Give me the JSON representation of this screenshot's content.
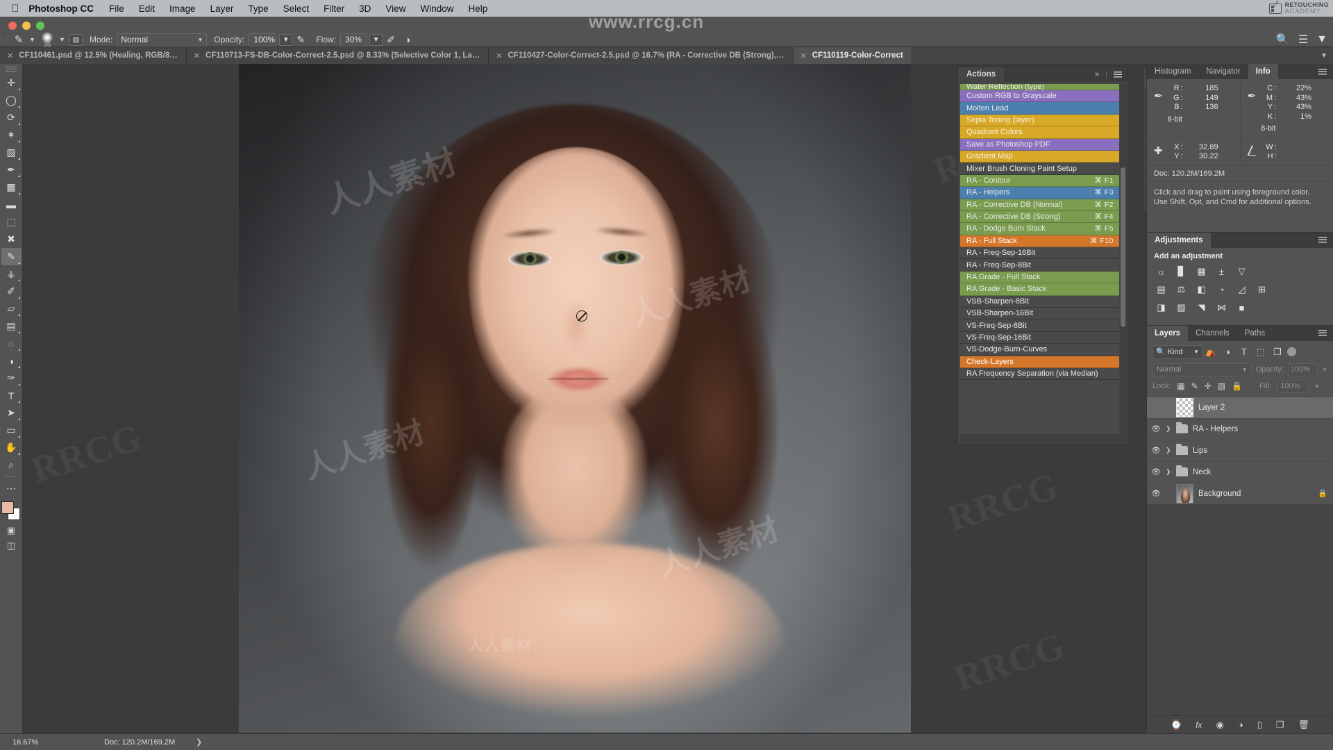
{
  "os_menu": {
    "apple_icon": "apple-icon",
    "app_name": "Photoshop CC",
    "items": [
      "File",
      "Edit",
      "Image",
      "Layer",
      "Type",
      "Select",
      "Filter",
      "3D",
      "View",
      "Window",
      "Help"
    ],
    "brand": {
      "line1": "RETOUCHING",
      "line2": "ACADEMY"
    }
  },
  "options_bar": {
    "tool_icon": "brush-tool-icon",
    "brush_size": "35",
    "brush_panel_icon": "brush-panel-icon",
    "mode_label": "Mode:",
    "mode_value": "Normal",
    "opacity_label": "Opacity:",
    "opacity_value": "100%",
    "opacity_pressure_icon": "pressure-opacity-icon",
    "flow_label": "Flow:",
    "flow_value": "30%",
    "airbrush_icon": "airbrush-icon",
    "smoothing_icon": "smoothing-icon",
    "search_icon": "search-icon",
    "workspace_icon": "workspace-icon"
  },
  "tabs": [
    {
      "close": "×",
      "title": "CF110461.psd @ 12.5% (Healing, RGB/8…",
      "active": false
    },
    {
      "close": "×",
      "title": "CF110713-FS-DB-Color-Correct-2.5.psd @ 8.33% (Selective Color 1, La…",
      "active": false
    },
    {
      "close": "×",
      "title": "CF110427-Color-Correct-2.5.psd @ 16.7% (RA - Corrective DB (Strong),…",
      "active": false
    },
    {
      "close": "×",
      "title": "CF110119-Color-Correct",
      "active": true
    }
  ],
  "toolbar": {
    "tools": [
      {
        "name": "move-tool",
        "glyph": "✛",
        "has_submenu": true,
        "selected": false
      },
      {
        "name": "marquee-tool",
        "glyph": "◯",
        "has_submenu": true,
        "selected": false
      },
      {
        "name": "lasso-tool",
        "glyph": "⤵",
        "has_submenu": true,
        "selected": false
      },
      {
        "name": "quick-selection-tool",
        "glyph": "✦",
        "has_submenu": true,
        "selected": false
      },
      {
        "name": "crop-tool",
        "glyph": "⌧",
        "has_submenu": true,
        "selected": false
      },
      {
        "name": "eyedropper-tool",
        "glyph": "✒",
        "has_submenu": true,
        "selected": false
      },
      {
        "name": "spot-healing-brush-tool",
        "glyph": "◩",
        "has_submenu": true,
        "selected": false
      },
      {
        "name": "healing-brush-tool",
        "glyph": "✐",
        "has_submenu": false,
        "selected": false
      },
      {
        "name": "patch-tool",
        "glyph": "⬚",
        "has_submenu": false,
        "selected": false
      },
      {
        "name": "content-aware-move-tool",
        "glyph": "✖",
        "has_submenu": false,
        "selected": false
      },
      {
        "name": "brush-tool",
        "glyph": "✐",
        "has_submenu": true,
        "selected": true
      },
      {
        "name": "clone-stamp-tool",
        "glyph": "⚑",
        "has_submenu": true,
        "selected": false
      },
      {
        "name": "history-brush-tool",
        "glyph": "✒",
        "has_submenu": true,
        "selected": false
      },
      {
        "name": "eraser-tool",
        "glyph": "▱",
        "has_submenu": true,
        "selected": false
      },
      {
        "name": "gradient-tool",
        "glyph": "▤",
        "has_submenu": true,
        "selected": false
      },
      {
        "name": "blur-tool",
        "glyph": "◌",
        "has_submenu": true,
        "selected": false
      },
      {
        "name": "dodge-tool",
        "glyph": "◑",
        "has_submenu": true,
        "selected": false
      },
      {
        "name": "pen-tool",
        "glyph": "✑",
        "has_submenu": true,
        "selected": false
      },
      {
        "name": "type-tool",
        "glyph": "T",
        "has_submenu": true,
        "selected": false
      },
      {
        "name": "path-selection-tool",
        "glyph": "➤",
        "has_submenu": true,
        "selected": false
      },
      {
        "name": "rectangle-tool",
        "glyph": "▭",
        "has_submenu": true,
        "selected": false
      },
      {
        "name": "hand-tool",
        "glyph": "✋",
        "has_submenu": true,
        "selected": false
      },
      {
        "name": "zoom-tool",
        "glyph": "⌕",
        "has_submenu": false,
        "selected": false
      },
      {
        "name": "more-tools",
        "glyph": "⋯",
        "has_submenu": false,
        "selected": false
      }
    ],
    "foreground_color": "#e8b9a4",
    "background_color": "#ffffff",
    "quick-mask-icon": "quick-mask-icon",
    "screen-mode-icon": "screen-mode-icon"
  },
  "actions_panel": {
    "tab_label": "Actions",
    "collapse_icon": "chevron-double-right-icon",
    "menu_icon": "panel-menu-icon",
    "items": [
      {
        "label": "Water Reflection (type)",
        "key": "",
        "color": "green",
        "clipped": true
      },
      {
        "label": "Custom RGB to Grayscale",
        "key": "",
        "color": "purple"
      },
      {
        "label": "Molten Lead",
        "key": "",
        "color": "blue"
      },
      {
        "label": "Sepia Toning (layer)",
        "key": "",
        "color": "gold"
      },
      {
        "label": "Quadrant Colors",
        "key": "",
        "color": "gold"
      },
      {
        "label": "Save as Photoshop PDF",
        "key": "",
        "color": "purple"
      },
      {
        "label": "Gradient Map",
        "key": "",
        "color": "gold"
      },
      {
        "label": "Mixer Brush Cloning Paint Setup",
        "key": "",
        "color": "plain"
      },
      {
        "label": "RA - Contour",
        "key": "⌘ F1",
        "color": "green"
      },
      {
        "label": "RA - Helpers",
        "key": "⌘ F3",
        "color": "bluesel"
      },
      {
        "label": "RA - Corrective DB (Normal)",
        "key": "⌘ F2",
        "color": "green"
      },
      {
        "label": "RA - Corrective DB (Strong)",
        "key": "⌘ F4",
        "color": "green"
      },
      {
        "label": "RA - Dodge Burn Stack",
        "key": "⌘ F5",
        "color": "green"
      },
      {
        "label": "RA - Full Stack",
        "key": "⌘ F10",
        "color": "orange"
      },
      {
        "label": "RA - Freq-Sep-16Bit",
        "key": "",
        "color": "plain"
      },
      {
        "label": "RA - Freq-Sep-8Bit",
        "key": "",
        "color": "plain"
      },
      {
        "label": "RA Grade - Full Stack",
        "key": "",
        "color": "green"
      },
      {
        "label": "RA Grade - Basic Stack",
        "key": "",
        "color": "green"
      },
      {
        "label": "VSB-Sharpen-8Bit",
        "key": "",
        "color": "plain"
      },
      {
        "label": "VSB-Sharpen-16Bit",
        "key": "",
        "color": "plain"
      },
      {
        "label": "VS-Freq-Sep-8Bit",
        "key": "",
        "color": "plain"
      },
      {
        "label": "VS-Freq-Sep-16Bit",
        "key": "",
        "color": "plain"
      },
      {
        "label": "VS-Dodge-Burn-Curves",
        "key": "",
        "color": "plain"
      },
      {
        "label": "Check-Layers",
        "key": "",
        "color": "orange"
      },
      {
        "label": "RA Frequency Separation (via Median)",
        "key": "",
        "color": "plain"
      }
    ]
  },
  "icon_dock": {
    "groups": [
      [
        {
          "name": "play-action-icon",
          "glyph": "▶",
          "active": true
        }
      ],
      [
        {
          "name": "libraries-icon",
          "glyph": "⎇",
          "active": false
        },
        {
          "name": "3d-icon",
          "glyph": "⬛",
          "active": false
        }
      ],
      [
        {
          "name": "brush-presets-icon",
          "glyph": "❁",
          "active": false
        },
        {
          "name": "brush-settings-icon",
          "glyph": "⚒",
          "active": false
        }
      ],
      [
        {
          "name": "tool-presets-icon",
          "glyph": "☰",
          "active": false
        }
      ]
    ]
  },
  "info_panel": {
    "tabs": [
      "Histogram",
      "Navigator",
      "Info"
    ],
    "active_tab": "Info",
    "menu_icon": "panel-menu-icon",
    "rgb": {
      "icon": "eyedropper-icon",
      "R": "185",
      "G": "149",
      "B": "136",
      "bit": "8-bit"
    },
    "cmyk": {
      "icon": "eyedropper-icon",
      "C": "22%",
      "M": "43%",
      "Y": "43%",
      "K": "1%",
      "bit": "8-bit"
    },
    "position": {
      "icon": "crosshair-icon",
      "X": "32.89",
      "Y": "30.22"
    },
    "size": {
      "icon": "selection-size-icon",
      "W": "",
      "H": ""
    },
    "doc": "Doc: 120.2M/169.2M",
    "hint": "Click and drag to paint using foreground color.  Use Shift, Opt, and Cmd for additional options."
  },
  "adjustments_panel": {
    "title": "Adjustments",
    "menu_icon": "panel-menu-icon",
    "subtitle": "Add an adjustment",
    "rows": [
      [
        {
          "name": "brightness-contrast-icon",
          "glyph": "☼"
        },
        {
          "name": "levels-icon",
          "glyph": "░"
        },
        {
          "name": "curves-icon",
          "glyph": "▦"
        },
        {
          "name": "exposure-icon",
          "glyph": "±"
        },
        {
          "name": "vibrance-icon",
          "glyph": "▽"
        }
      ],
      [
        {
          "name": "hue-saturation-icon",
          "glyph": "▤"
        },
        {
          "name": "color-balance-icon",
          "glyph": "⚖"
        },
        {
          "name": "black-white-icon",
          "glyph": "◧"
        },
        {
          "name": "photo-filter-icon",
          "glyph": "◔"
        },
        {
          "name": "channel-mixer-icon",
          "glyph": "✿"
        },
        {
          "name": "color-lookup-icon",
          "glyph": "⊞"
        }
      ],
      [
        {
          "name": "invert-icon",
          "glyph": "◨"
        },
        {
          "name": "posterize-icon",
          "glyph": "▧"
        },
        {
          "name": "threshold-icon",
          "glyph": "◥"
        },
        {
          "name": "selective-color-icon",
          "glyph": "⋈"
        },
        {
          "name": "gradient-map-icon",
          "glyph": "■"
        }
      ]
    ]
  },
  "layers_panel": {
    "tabs": [
      "Layers",
      "Channels",
      "Paths"
    ],
    "active_tab": "Layers",
    "menu_icon": "panel-menu-icon",
    "filter": {
      "kind_label": "Kind",
      "search_icon": "search-icon",
      "caret_icon": "chevron-down-icon",
      "filters": [
        {
          "name": "filter-pixel-icon",
          "glyph": "⛰"
        },
        {
          "name": "filter-adjustment-icon",
          "glyph": "◑"
        },
        {
          "name": "filter-type-icon",
          "glyph": "T"
        },
        {
          "name": "filter-shape-icon",
          "glyph": "⬚"
        },
        {
          "name": "filter-smart-object-icon",
          "glyph": "❐"
        }
      ],
      "toggle": "filter-enable-toggle"
    },
    "blend_mode": "Normal",
    "opacity_label": "Opacity:",
    "opacity_value": "100%",
    "lock_label": "Lock:",
    "lock_icons": [
      {
        "name": "lock-transparent-pixels-icon",
        "glyph": "░"
      },
      {
        "name": "lock-image-pixels-icon",
        "glyph": "✐"
      },
      {
        "name": "lock-position-icon",
        "glyph": "✛"
      },
      {
        "name": "lock-artboard-icon",
        "glyph": "⌧"
      },
      {
        "name": "lock-all-icon",
        "glyph": "🔒"
      }
    ],
    "fill_label": "Fill:",
    "fill_value": "100%",
    "layers": [
      {
        "name": "Layer 2",
        "type": "pixel",
        "visible": false,
        "selected": true,
        "expandable": false,
        "locked": false
      },
      {
        "name": "RA - Helpers",
        "type": "group",
        "visible": true,
        "selected": false,
        "expandable": true,
        "locked": false
      },
      {
        "name": "Lips",
        "type": "group",
        "visible": true,
        "selected": false,
        "expandable": true,
        "locked": false
      },
      {
        "name": "Neck",
        "type": "group",
        "visible": true,
        "selected": false,
        "expandable": true,
        "locked": false
      },
      {
        "name": "Background",
        "type": "photo",
        "visible": true,
        "selected": false,
        "expandable": false,
        "locked": true
      }
    ],
    "bottom_icons": [
      {
        "name": "link-layers-icon",
        "glyph": "⚭"
      },
      {
        "name": "layer-style-icon",
        "glyph": "fx"
      },
      {
        "name": "layer-mask-icon",
        "glyph": "◐"
      },
      {
        "name": "new-fill-adjustment-icon",
        "glyph": "◑"
      },
      {
        "name": "new-group-icon",
        "glyph": "▱"
      },
      {
        "name": "new-layer-icon",
        "glyph": "❐"
      },
      {
        "name": "delete-layer-icon",
        "glyph": "🗑"
      }
    ]
  },
  "status_bar": {
    "zoom": "16.67%",
    "doc": "Doc: 120.2M/169.2M",
    "arrow_icon": "chevron-right-icon"
  },
  "watermarks": {
    "site": "www.rrcg.cn",
    "rrcg": "RRCG",
    "cn": "人人素材",
    "bottom_brand": "人人素材"
  },
  "colors": {
    "chrome": "#535353",
    "panel": "#454545",
    "selection_blue": "#4b7fae",
    "highlight_orange": "#d4772a",
    "action_green": "#7a9c4f",
    "action_gold": "#d8a827",
    "action_purple": "#8a6fbe"
  }
}
